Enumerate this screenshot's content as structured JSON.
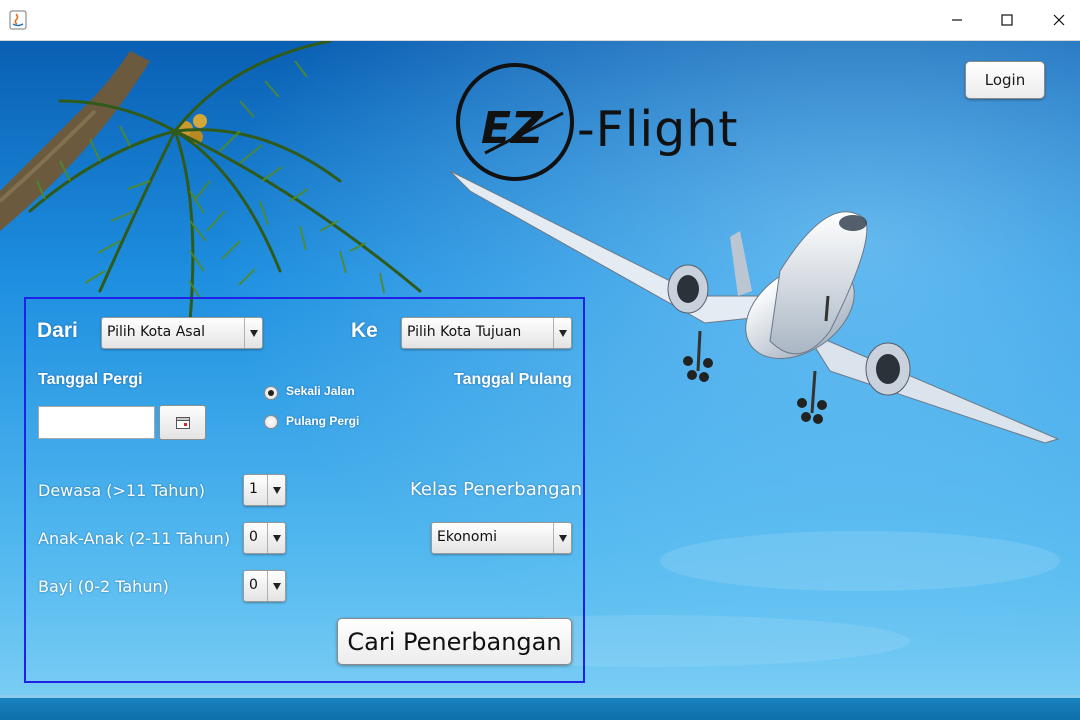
{
  "window": {
    "title": "",
    "controls": {
      "minimize": "minimize-icon",
      "maximize": "maximize-icon",
      "close": "close-icon"
    }
  },
  "header": {
    "login_label": "Login",
    "logo": {
      "mark": "EZ",
      "text": "-Flight"
    }
  },
  "form": {
    "dari_label": "Dari",
    "ke_label": "Ke",
    "kota_asal": "Pilih Kota Asal",
    "kota_tujuan": "Pilih Kota Tujuan",
    "tanggal_pergi_label": "Tanggal Pergi",
    "tanggal_pulang_label": "Tanggal Pulang",
    "tanggal_pergi_value": "",
    "trip_options": [
      {
        "label": "Sekali Jalan",
        "selected": true
      },
      {
        "label": "Pulang Pergi",
        "selected": false
      }
    ],
    "dewasa_label": "Dewasa (>11 Tahun)",
    "dewasa_value": "1",
    "anak_label": "Anak-Anak (2-11 Tahun)",
    "anak_value": "0",
    "bayi_label": "Bayi (0-2 Tahun)",
    "bayi_value": "0",
    "kelas_label": "Kelas Penerbangan",
    "kelas_value": "Ekonomi",
    "search_label": "Cari Penerbangan"
  },
  "colors": {
    "panel_border": "#1e22e6",
    "sky_top": "#0a5fb3",
    "sky_bottom": "#7fd0f5"
  }
}
